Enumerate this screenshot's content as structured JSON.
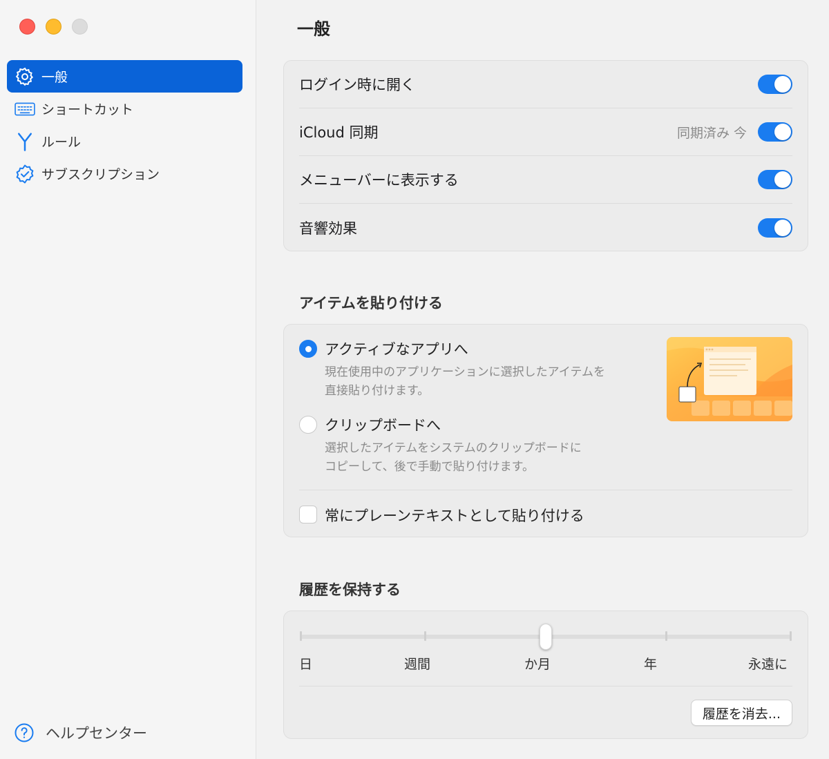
{
  "window": {
    "traffic_lights": [
      "close",
      "minimize",
      "zoom"
    ]
  },
  "sidebar": {
    "items": [
      {
        "label": "一般",
        "icon": "gear-icon",
        "active": true
      },
      {
        "label": "ショートカット",
        "icon": "keyboard-icon",
        "active": false
      },
      {
        "label": "ルール",
        "icon": "fork-icon",
        "active": false
      },
      {
        "label": "サブスクリプション",
        "icon": "verified-badge-icon",
        "active": false
      }
    ],
    "help": {
      "label": "ヘルプセンター",
      "icon": "question-circle-icon"
    }
  },
  "main": {
    "title": "一般",
    "settings": [
      {
        "label": "ログイン時に開く",
        "on": true
      },
      {
        "label": "iCloud 同期",
        "status": "同期済み 今",
        "on": true
      },
      {
        "label": "メニューバーに表示する",
        "on": true
      },
      {
        "label": "音響効果",
        "on": true
      }
    ],
    "paste": {
      "title": "アイテムを貼り付ける",
      "options": [
        {
          "label": "アクティブなアプリへ",
          "desc1": "現在使用中のアプリケーションに選択したアイテムを",
          "desc2": "直接貼り付けます。",
          "selected": true
        },
        {
          "label": "クリップボードへ",
          "desc1": "選択したアイテムをシステムのクリップボードに",
          "desc2": "コピーして、後で手動で貼り付けます。",
          "selected": false
        }
      ],
      "plain_text_label": "常にプレーンテキストとして貼り付ける",
      "plain_text_checked": false
    },
    "history": {
      "title": "履歴を保持する",
      "stops": [
        "日",
        "週間",
        "か月",
        "年",
        "永遠に"
      ],
      "selected_index": 2,
      "clear_button": "履歴を消去..."
    }
  },
  "colors": {
    "accent": "#1a7cf0",
    "sidebar_active": "#0a63d8"
  }
}
